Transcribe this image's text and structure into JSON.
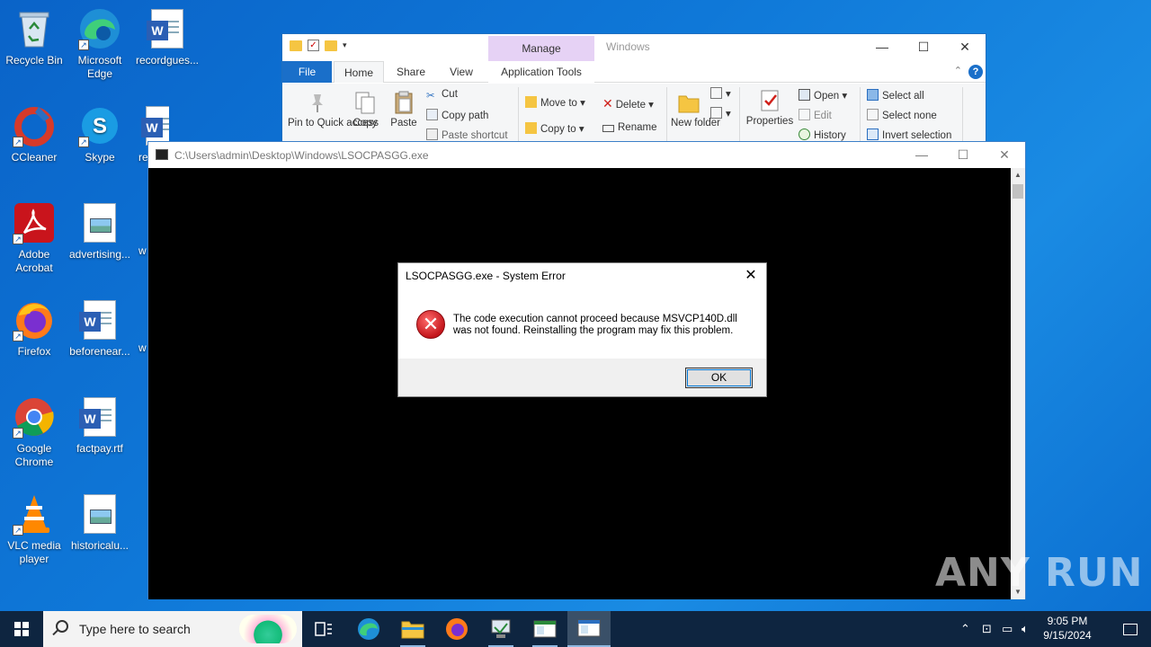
{
  "desktop": {
    "icons": [
      {
        "label": "Recycle Bin",
        "icon": "recycle-bin-icon"
      },
      {
        "label": "Microsoft Edge",
        "icon": "edge-icon"
      },
      {
        "label": "recordgues...",
        "icon": "word-doc-icon"
      },
      {
        "label": "CCleaner",
        "icon": "ccleaner-icon"
      },
      {
        "label": "Skype",
        "icon": "skype-icon"
      },
      {
        "label": "re",
        "icon": "word-doc-icon"
      },
      {
        "label": "Adobe Acrobat",
        "icon": "acrobat-icon"
      },
      {
        "label": "advertising...",
        "icon": "image-file-icon"
      },
      {
        "label": "w",
        "icon": "word-doc-icon"
      },
      {
        "label": "Firefox",
        "icon": "firefox-icon"
      },
      {
        "label": "beforenear...",
        "icon": "word-doc-icon"
      },
      {
        "label": "w",
        "icon": "word-doc-icon"
      },
      {
        "label": "Google Chrome",
        "icon": "chrome-icon"
      },
      {
        "label": "factpay.rtf",
        "icon": "word-doc-icon"
      },
      {
        "label": "VLC media player",
        "icon": "vlc-icon"
      },
      {
        "label": "historicalu...",
        "icon": "image-file-icon"
      }
    ]
  },
  "explorer": {
    "window_title": "Windows",
    "manage_label": "Manage",
    "tabs": {
      "file": "File",
      "home": "Home",
      "share": "Share",
      "view": "View",
      "app_tools": "Application Tools"
    },
    "ribbon": {
      "pin": "Pin to Quick access",
      "copy": "Copy",
      "paste": "Paste",
      "cut": "Cut",
      "copy_path": "Copy path",
      "paste_shortcut": "Paste shortcut",
      "move_to": "Move to",
      "copy_to": "Copy to",
      "delete": "Delete",
      "rename": "Rename",
      "new_folder": "New folder",
      "properties": "Properties",
      "open": "Open",
      "edit": "Edit",
      "history": "History",
      "select_all": "Select all",
      "select_none": "Select none",
      "invert_selection": "Invert selection"
    }
  },
  "console": {
    "title": "C:\\Users\\admin\\Desktop\\Windows\\LSOCPASGG.exe"
  },
  "dialog": {
    "title": "LSOCPASGG.exe - System Error",
    "message_line1": "The code execution cannot proceed because MSVCP140D.dll",
    "message_line2": "was not found. Reinstalling the program may fix this problem.",
    "ok_label": "OK"
  },
  "watermark": "ANY RUN",
  "taskbar": {
    "search_placeholder": "Type here to search",
    "time": "9:05 PM",
    "date": "9/15/2024"
  },
  "colors": {
    "desktop": "#0f78d8",
    "taskbar": "#0e2540",
    "accent": "#1a6fc9",
    "error_red": "#c4161c"
  }
}
